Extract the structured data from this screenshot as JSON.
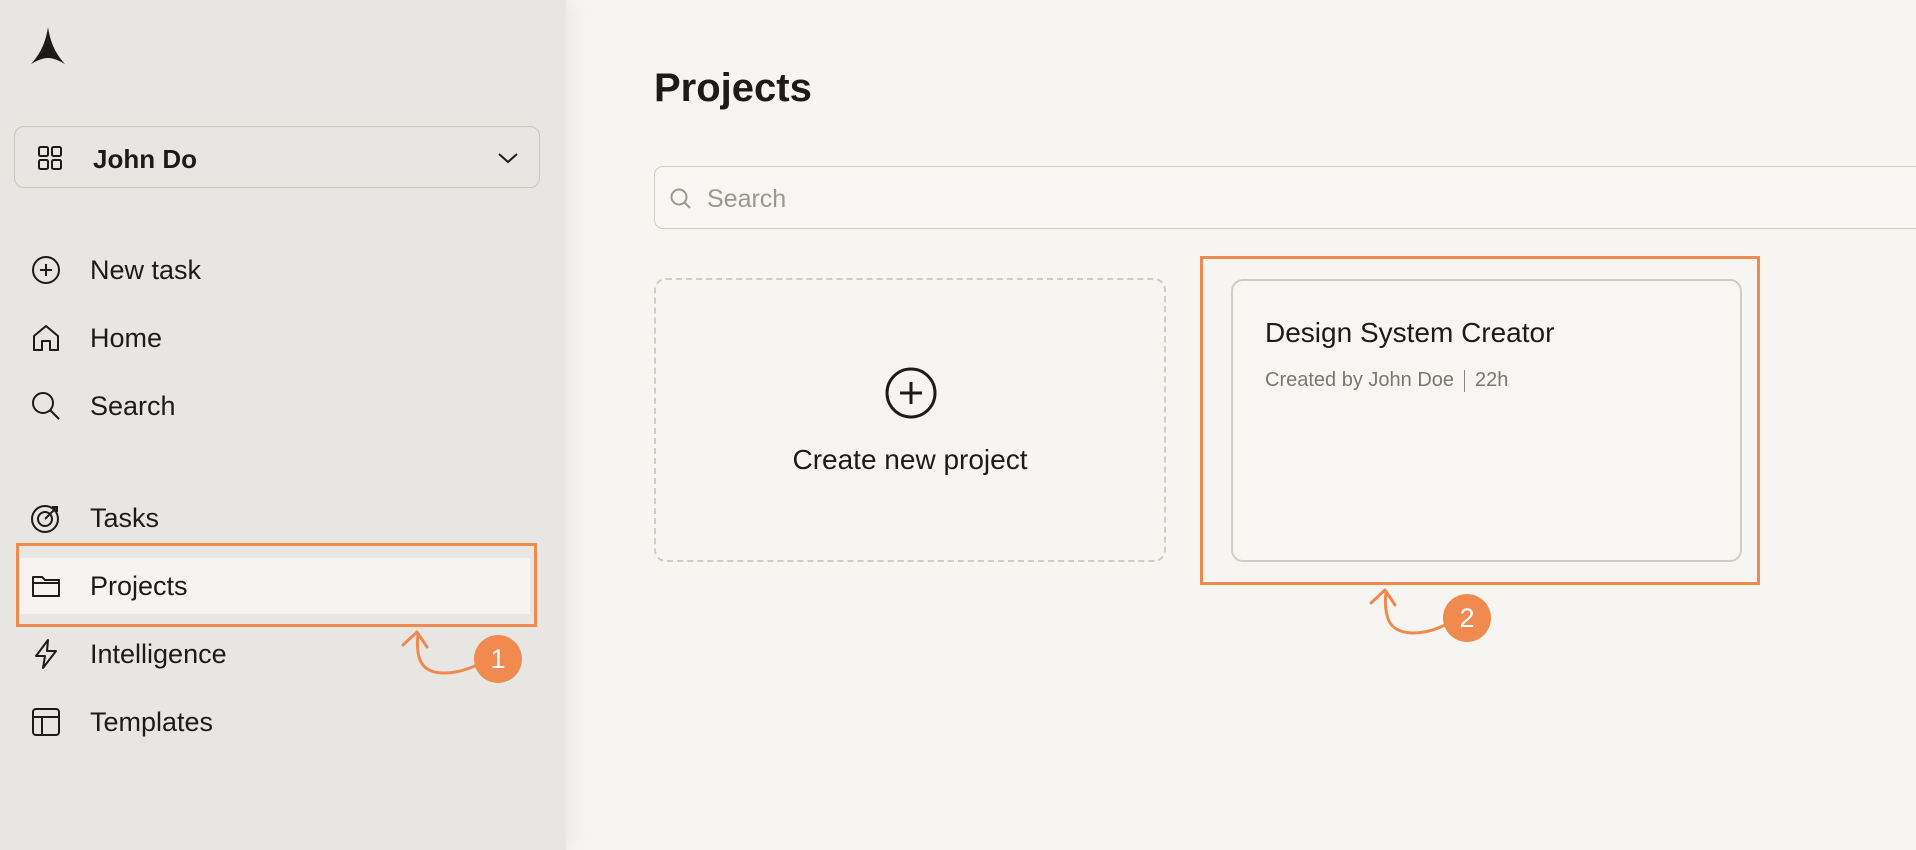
{
  "sidebar": {
    "workspace": {
      "name": "John Do"
    },
    "items": [
      {
        "label": "New task",
        "icon": "plus-circle-icon"
      },
      {
        "label": "Home",
        "icon": "home-icon"
      },
      {
        "label": "Search",
        "icon": "search-icon"
      },
      {
        "label": "Tasks",
        "icon": "target-icon"
      },
      {
        "label": "Projects",
        "icon": "folder-icon",
        "active": true
      },
      {
        "label": "Intelligence",
        "icon": "lightning-icon"
      },
      {
        "label": "Templates",
        "icon": "layout-icon"
      }
    ]
  },
  "main": {
    "title": "Projects",
    "search": {
      "placeholder": "Search",
      "value": ""
    },
    "create_card": {
      "label": "Create new project"
    },
    "projects": [
      {
        "title": "Design System Creator",
        "creator": "Created by John Doe",
        "age": "22h"
      }
    ]
  },
  "annotations": {
    "accent_color": "#ef8a4f",
    "badges": [
      "1",
      "2"
    ]
  }
}
